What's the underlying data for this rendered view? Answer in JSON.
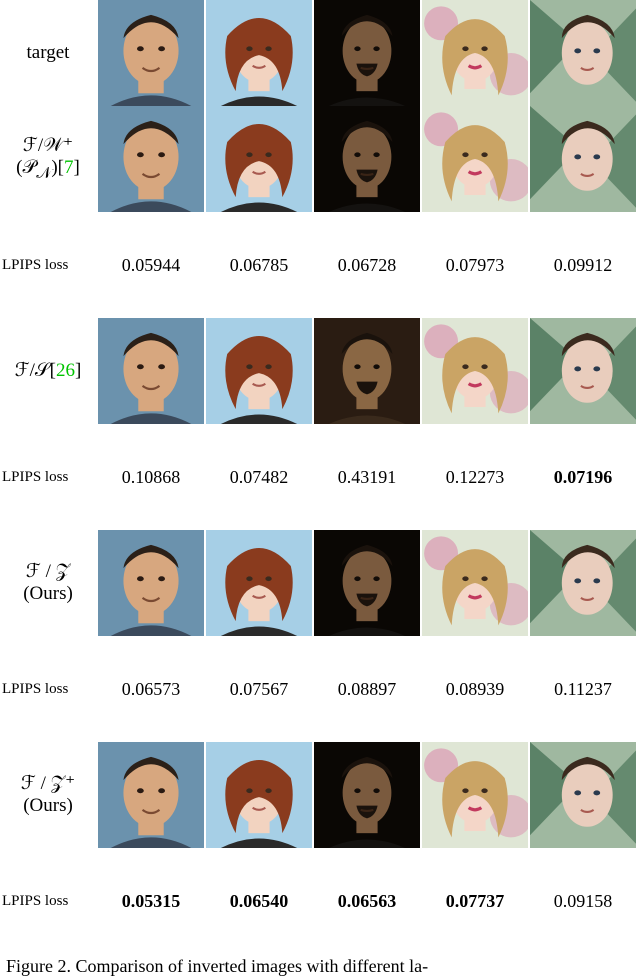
{
  "labels": {
    "row0": "target",
    "row1_l1": "ℱ/𝒲⁺",
    "row1_l2_pre": "(𝒫",
    "row1_l2_sub": "𝒩",
    "row1_l2_post": ")[",
    "row1_cite": "7",
    "row1_l2_close": "]",
    "row2_pre": "ℱ/𝒮[",
    "row2_cite": "26",
    "row2_post": "]",
    "row3_l1": "ℱ / 𝒵",
    "row3_l2": "(Ours)",
    "row4_l1": "ℱ / 𝒵⁺",
    "row4_l2": "(Ours)",
    "metric_label": "LPIPS loss"
  },
  "metrics": {
    "r1": [
      "0.05944",
      "0.06785",
      "0.06728",
      "0.07973",
      "0.09912"
    ],
    "r2": [
      "0.10868",
      "0.07482",
      "0.43191",
      "0.12273",
      "0.07196"
    ],
    "r3": [
      "0.06573",
      "0.07567",
      "0.08897",
      "0.08939",
      "0.11237"
    ],
    "r4": [
      "0.05315",
      "0.06540",
      "0.06563",
      "0.07737",
      "0.09158"
    ]
  },
  "bold": {
    "r1": [
      false,
      false,
      false,
      false,
      false
    ],
    "r2": [
      false,
      false,
      false,
      false,
      true
    ],
    "r3": [
      false,
      false,
      false,
      false,
      false
    ],
    "r4": [
      true,
      true,
      true,
      true,
      false
    ]
  },
  "faces": {
    "cols": [
      {
        "bg": "#6b92ad",
        "skin": "#d7a77f",
        "hair": "#2b2018"
      },
      {
        "bg": "#a6cfe6",
        "skin": "#f2d3c0",
        "hair": "#8a3b1e"
      },
      {
        "bg": "#0a0704",
        "skin": "#7a5a3e",
        "hair": "#1a120c"
      },
      {
        "bg": "#dfe6d5",
        "skin": "#f4d6c8",
        "hair": "#caa465"
      },
      {
        "bg": "#9fb8a0",
        "skin": "#e9cdbd",
        "hair": "#3b2a1e"
      }
    ]
  },
  "caption": "Figure 2.  Comparison of inverted images with different la-"
}
